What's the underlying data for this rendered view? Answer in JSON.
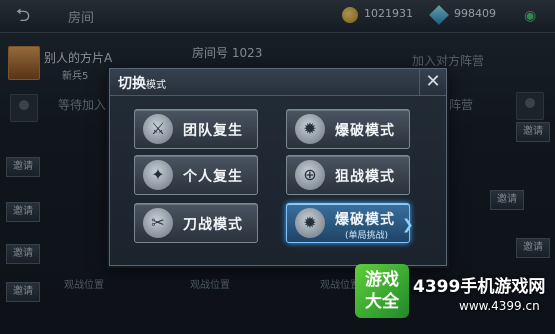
{
  "topbar": {
    "title": "房间",
    "coins": "1021931",
    "gems": "998409"
  },
  "room": {
    "number_label": "房间号 1023",
    "player_name": "别人的方片A",
    "player_level": "新兵5",
    "invite_opponent": "加入对方阵营",
    "waiting": "等待加入...",
    "opponent_camp": "对方阵营",
    "invite_label": "邀请",
    "spectator_label": "观战位置"
  },
  "modal": {
    "title": "切换",
    "title_suffix": "模式",
    "close_glyph": "✕",
    "modes": [
      {
        "label": "团队复生",
        "icon": "team-respawn-icon"
      },
      {
        "label": "爆破模式",
        "icon": "bomb-mode-icon"
      },
      {
        "label": "个人复生",
        "icon": "solo-respawn-icon"
      },
      {
        "label": "狙战模式",
        "icon": "sniper-mode-icon"
      },
      {
        "label": "刀战模式",
        "icon": "knife-mode-icon"
      },
      {
        "label": "爆破模式",
        "sub": "(单局挑战)",
        "icon": "bomb-challenge-icon",
        "selected": true
      }
    ]
  },
  "watermark": {
    "logo_line1": "游戏",
    "logo_line2": "大全",
    "brand": "4399手机游戏网",
    "url": "www.4399.cn"
  }
}
